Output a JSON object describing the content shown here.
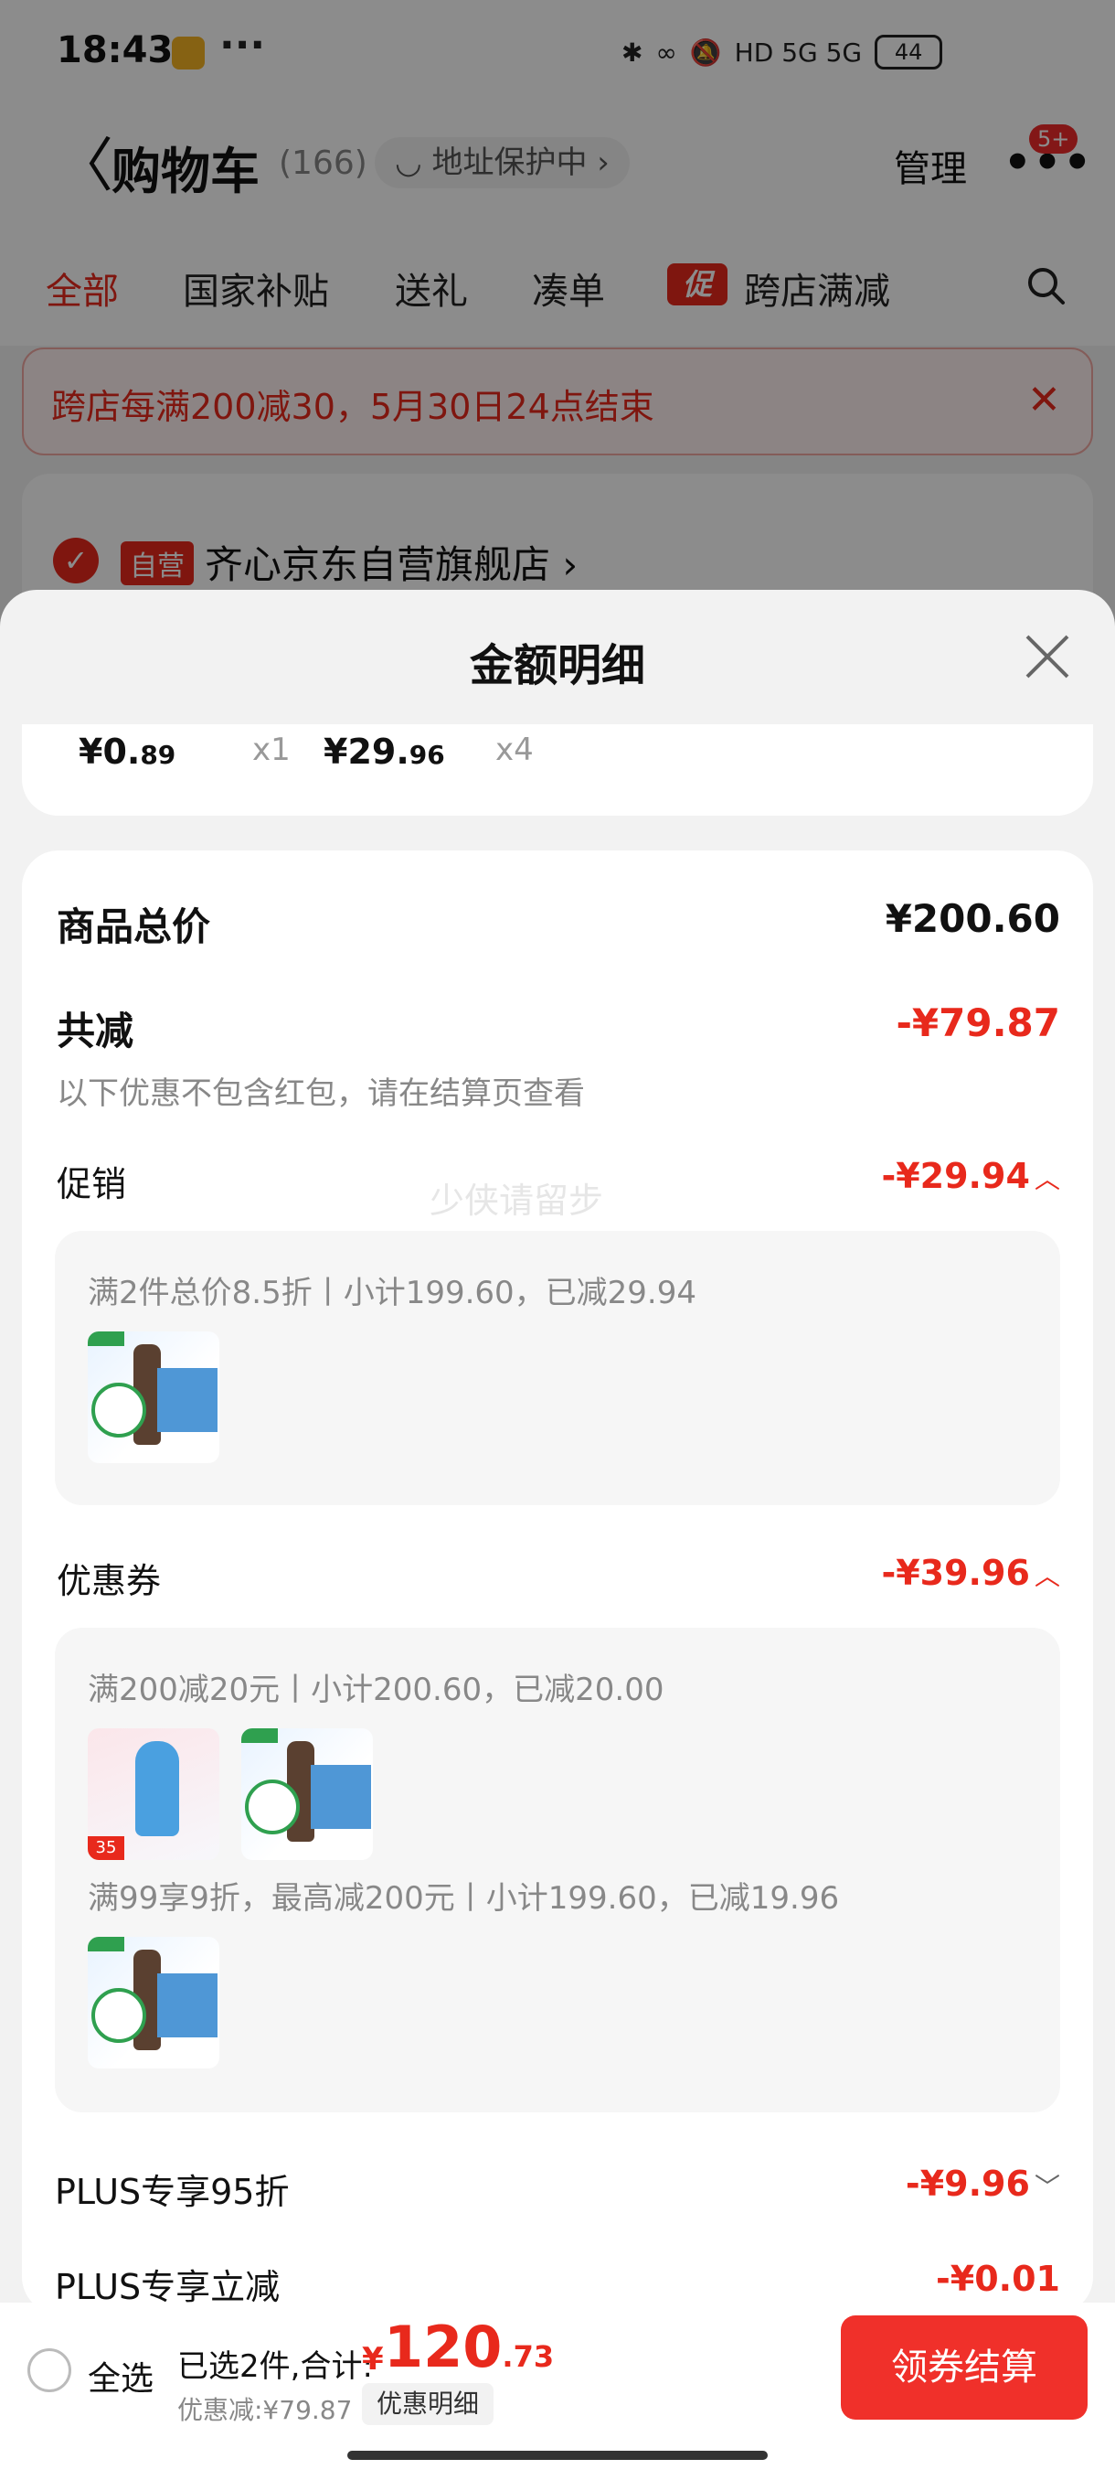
{
  "status": {
    "time": "18:43",
    "dots": "···",
    "net": "HD 5G 5G",
    "battery": "44"
  },
  "header": {
    "back": "〈",
    "title": "购物车",
    "count": "(166)",
    "address": "◡ 地址保护中 ›",
    "manage": "管理",
    "more": "•••",
    "badge": "5+"
  },
  "tabs": [
    "全部",
    "国家补贴",
    "送礼",
    "凑单",
    "跨店满减"
  ],
  "tab_cu": "促",
  "banner": {
    "text": "跨店每满200减30，5月30日24点结束",
    "close": "✕"
  },
  "store": {
    "self": "自营",
    "name": "齐心京东自营旗舰店 ›"
  },
  "sheet": {
    "title": "金额明细"
  },
  "items": [
    {
      "price_main": "¥0.",
      "price_dec": "89",
      "qty": "x1"
    },
    {
      "price_main": "¥29.",
      "price_dec": "96",
      "qty": "x4"
    }
  ],
  "summary": {
    "goods_label": "商品总价",
    "goods_value": "¥200.60",
    "reduce_label": "共减",
    "reduce_value": "-¥79.87",
    "note": "以下优惠不包含红包，请在结算页查看",
    "promo_label": "促销",
    "promo_value": "-¥29.94",
    "promo_detail": "满2件总价8.5折丨小计199.60，已减29.94",
    "coupon_label": "优惠券",
    "coupon_value": "-¥39.96",
    "coupon_detail1": "满200减20元丨小计200.60，已减20.00",
    "coupon_detail2": "满99享9折，最高减200元丨小计199.60，已减19.96",
    "plus95_label": "PLUS专享95折",
    "plus95_value": "-¥9.96",
    "plusnow_label": "PLUS专享立减",
    "plusnow_value": "-¥0.01",
    "watermark": "少侠请留步",
    "thumb_tag": "35"
  },
  "bottom": {
    "all": "全选",
    "selected": "已选2件,合计:",
    "yen": "¥",
    "total_int": "120",
    "total_dec": ".73",
    "saved": "优惠减:¥79.87",
    "detail": "优惠明细",
    "checkout": "领券结算"
  }
}
